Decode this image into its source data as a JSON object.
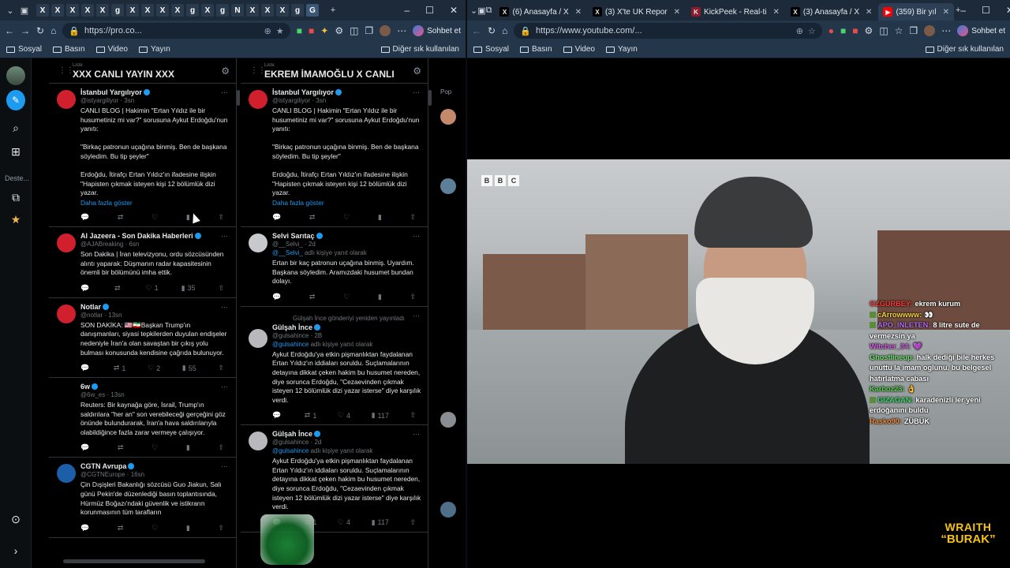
{
  "left_window": {
    "tabs": [
      "X",
      "X",
      "X",
      "X",
      "X",
      "g",
      "X",
      "X",
      "X",
      "X",
      "g",
      "X",
      "g",
      "N",
      "X",
      "X",
      "X",
      "g",
      "G"
    ],
    "address": "https://pro.co...",
    "chat_label": "Sohbet et",
    "favorites": [
      "Sosyal",
      "Basın",
      "Video",
      "Yayın"
    ],
    "favorites_other": "Diğer sık kullanılan",
    "nav": {
      "deste_label": "Deste..."
    },
    "columns": [
      {
        "kicker": "Liste",
        "title": "XXX CANLI YAYIN XXX",
        "tweets": [
          {
            "name": "İstanbul Yargılıyor",
            "handle": "@istyargiliyor · 3sn",
            "avatar_color": "#d0202e",
            "body": "CANLI BLOG | Hakimin \"Ertan Yıldız ile bir husumetiniz mi var?\" sorusuna Aykut Erdoğdu'nun yanıtı:\n\n\"Birkaç patronun uçağına binmiş. Ben de başkana söyledim. Bu tip şeyler\"\n\nErdoğdu, İtirafçı Ertan Yıldız'ın ifadesine ilişkin \"Hapisten çıkmak isteyen kişi 12 bölümlük dizi yazar.",
            "link": "Daha fazla göster",
            "actions": [
              "",
              "",
              "",
              "",
              ""
            ]
          },
          {
            "name": "Al Jazeera - Son Dakika Haberleri",
            "handle": "@AJABreaking · 6sn",
            "avatar_color": "#d0202e",
            "body": "Son Dakika | İran televizyonu, ordu sözcüsünden alıntı yaparak: Düşmanın radar kapasitesinin önemli bir bölümünü imha ettik.",
            "actions": [
              "",
              "",
              "1",
              "35",
              ""
            ]
          },
          {
            "name": "Notlar",
            "handle": "@notlar · 13sn",
            "avatar_color": "#d0202e",
            "body": "SON DAKİKA: 🇺🇸🇮🇷Başkan Trump'ın danışmanları, siyasi tepkilerden duyulan endişeler nedeniyle İran'a olan savaştan bir çıkış yolu bulması konusunda kendisine çağrıda bulunuyor.",
            "actions": [
              "",
              "1",
              "2",
              "55",
              ""
            ]
          },
          {
            "name": "6w",
            "handle": "@6w_es · 13sn",
            "avatar_color": "#000000",
            "body": "Reuters: Bir kaynağa göre, İsrail, Trump'ın saldırılara \"her an\" son verebileceği gerçeğini göz önünde bulundurarak, İran'a hava saldırılarıyla olabildiğince fazla zarar vermeye çalışıyor.",
            "actions": [
              "",
              "",
              "",
              "",
              ""
            ]
          },
          {
            "name": "CGTN Avrupa",
            "handle": "@CGTNEurope · 16sn",
            "avatar_color": "#1c5fa8",
            "body": "Çin Dışişleri Bakanlığı sözcüsü Guo Jiakun, Salı günü Pekin'de düzenlediği basın toplantısında, Hürmüz Boğazı'ndaki güvenlik ve istikrarın korunmasının tüm tarafların",
            "actions": [
              "",
              "",
              "",
              "",
              ""
            ]
          }
        ]
      },
      {
        "kicker": "Liste",
        "title": "EKREM İMAMOĞLU X CANLI",
        "tweets": [
          {
            "name": "İstanbul Yargılıyor",
            "handle": "@istyargiliyor · 3sn",
            "avatar_color": "#d0202e",
            "body": "CANLI BLOG | Hakimin \"Ertan Yıldız ile bir husumetiniz mi var?\" sorusuna Aykut Erdoğdu'nun yanıtı:\n\n\"Birkaç patronun uçağına binmiş. Ben de başkana söyledim. Bu tip şeyler\"\n\nErdoğdu, İtirafçı Ertan Yıldız'ın ifadesine ilişkin \"Hapisten çıkmak isteyen kişi 12 bölümlük dizi yazar.",
            "link": "Daha fazla göster",
            "actions": [
              "",
              "",
              "",
              "",
              ""
            ]
          },
          {
            "name": "Selvi Sarıtaç",
            "handle": "@__Selvi_ · 2d",
            "avatar_color": "#c7c9cc",
            "reply_user": "@__Selvi_",
            "reply_text": "adlı kişiye yanıt olarak",
            "body": "Ertan bir kaç patronun uçağına binmiş. Uyardım. Başkana söyledim. Aramızdaki husumet bundan dolayı.",
            "actions": [
              "",
              "",
              "",
              "",
              ""
            ]
          },
          {
            "repost": "Gülşah İnce gönderiyi yeniden yayınladı",
            "name": "Gülşah İnce",
            "handle": "@gulsahince · 2B",
            "avatar_color": "#b9b9bd",
            "reply_user": "@gulsahince",
            "reply_text": "adlı kişiye yanıt olarak",
            "body": "Aykut Erdoğdu'ya etkin pişmanlıktan faydalanan Ertan Yıldız'ın iddiaları soruldu. Suçlamalarının detayına dikkat çeken hakim bu husumet nereden, diye sorunca Erdoğdu, \"Cezaevinden çıkmak isteyen 12 bölümlük dizi yazar isterse\" diye karşılık verdi.",
            "actions": [
              "",
              "1",
              "4",
              "117",
              ""
            ]
          },
          {
            "name": "Gülşah İnce",
            "handle": "@gulsahince · 2d",
            "avatar_color": "#b9b9bd",
            "reply_user": "@gulsahince",
            "reply_text": "adlı kişiye yanıt olarak",
            "body": "Aykut Erdoğdu'ya etkin pişmanlıktan faydalanan Ertan Yıldız'ın iddiaları soruldu. Suçlamalarının detayına dikkat çeken hakim bu husumet nereden, diye sorunca Erdoğdu, \"Cezaevinden çıkmak isteyen 12 bölümlük dizi yazar isterse\" diye karşılık verdi.",
            "actions": [
              "",
              "1",
              "4",
              "117",
              ""
            ]
          }
        ]
      }
    ],
    "peek_label": "Pop"
  },
  "right_window": {
    "tabs": [
      {
        "label": "(6) Anasayfa / X",
        "icon": "X",
        "color": "#000000",
        "active": false
      },
      {
        "label": "(3) X'te UK Repor",
        "icon": "X",
        "color": "#000000",
        "active": false
      },
      {
        "label": "KickPeek - Real-ti",
        "icon": "K",
        "color": "#8a1c2b",
        "active": false
      },
      {
        "label": "(3) Anasayfa / X",
        "icon": "X",
        "color": "#000000",
        "active": false
      },
      {
        "label": "(359) Bir yıl",
        "icon": "▶",
        "color": "#ff0000",
        "active": true
      }
    ],
    "address": "https://www.youtube.com/...",
    "chat_label": "Sohbet et",
    "favorites": [
      "Sosyal",
      "Basın",
      "Video",
      "Yayın"
    ],
    "favorites_other": "Diğer sık kullanılan",
    "video": {
      "watermark": [
        "B",
        "B",
        "C"
      ],
      "chat": [
        {
          "user": "OZGURBEY:",
          "user_color": "#ff3b3b",
          "msg": "ekrem kurum",
          "badge": false
        },
        {
          "user": "cArrowwww:",
          "user_color": "#f2d33b",
          "msg": "👀",
          "badge": true
        },
        {
          "user": "APO_INLETEN:",
          "user_color": "#b06cf0",
          "msg": "8 litre sute de vermezsin ya",
          "badge": true
        },
        {
          "user": "Witcher_34:",
          "user_color": "#d35ee0",
          "msg": "💜",
          "badge": false
        },
        {
          "user": "Ghostlineup:",
          "user_color": "#6fe06a",
          "msg": "halk dediği bile herkes unuttu la imam oglunu. bu belgesel hatırlatma cabası",
          "badge": false
        },
        {
          "user": "Karboz23:",
          "user_color": "#52d44b",
          "msg": "👌",
          "badge": false
        },
        {
          "user": "GIZAGAN:",
          "user_color": "#40e06c",
          "msg": "karadenizli ler yeni erdoğanını buldu",
          "badge": true
        },
        {
          "user": "Rasko90:",
          "user_color": "#f08a3b",
          "msg": "ZÜBÜK",
          "badge": false
        }
      ],
      "logo_line1": "WRAITH",
      "logo_line2": "“BURAK”"
    }
  },
  "colors": {
    "accent": "#1d9bf0",
    "tab_bar": "#1c2a3a",
    "toolbar": "#23364a",
    "deck_bg": "#000000"
  }
}
